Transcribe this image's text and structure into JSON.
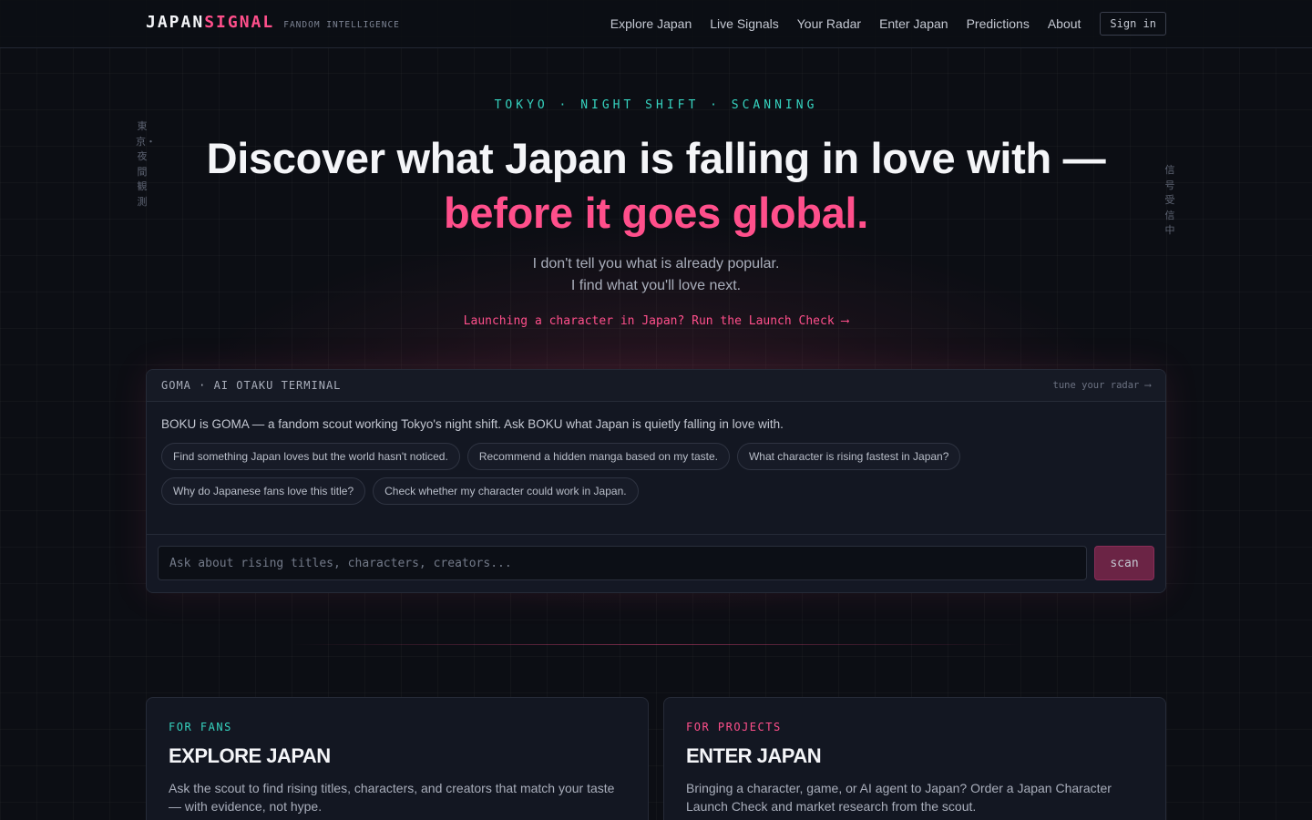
{
  "brand": {
    "name_a": "JAPAN",
    "name_b": "SIGNAL",
    "tagline": "FANDOM INTELLIGENCE"
  },
  "nav": {
    "links": [
      "Explore Japan",
      "Live Signals",
      "Your Radar",
      "Enter Japan",
      "Predictions",
      "About"
    ],
    "signin_label": "Sign in"
  },
  "side_text": {
    "left": "東京・夜間観測",
    "right": "信号受信中"
  },
  "hero": {
    "kicker": "TOKYO · NIGHT SHIFT · SCANNING",
    "headline_main": "Discover what Japan is falling in love with — ",
    "headline_accent": "before it goes global.",
    "sub_line1": "I don't tell you what is already popular.",
    "sub_line2": "I find what you'll love next.",
    "launch_link": "Launching a character in Japan? Run the Launch Check ⟶"
  },
  "terminal": {
    "title": "GOMA · AI OTAKU TERMINAL",
    "tune_link": "tune your radar ⟶",
    "intro": "BOKU is GOMA — a fandom scout working Tokyo's night shift. Ask BOKU what Japan is quietly falling in love with.",
    "chips": [
      "Find something Japan loves but the world hasn't noticed.",
      "Recommend a hidden manga based on my taste.",
      "What character is rising fastest in Japan?",
      "Why do Japanese fans love this title?",
      "Check whether my character could work in Japan."
    ],
    "input_placeholder": "Ask about rising titles, characters, creators...",
    "input_value": "",
    "scan_label": "scan"
  },
  "cards": [
    {
      "kicker": "FOR FANS",
      "title": "EXPLORE JAPAN",
      "desc": "Ask the scout to find rising titles, characters, and creators that match your taste — with evidence, not hype."
    },
    {
      "kicker": "FOR PROJECTS",
      "title": "ENTER JAPAN",
      "desc": "Bringing a character, game, or AI agent to Japan? Order a Japan Character Launch Check and market research from the scout."
    }
  ],
  "colors": {
    "accent_pink": "#ff4f8b",
    "accent_teal": "#36d4c0",
    "background": "#0c0e14"
  }
}
